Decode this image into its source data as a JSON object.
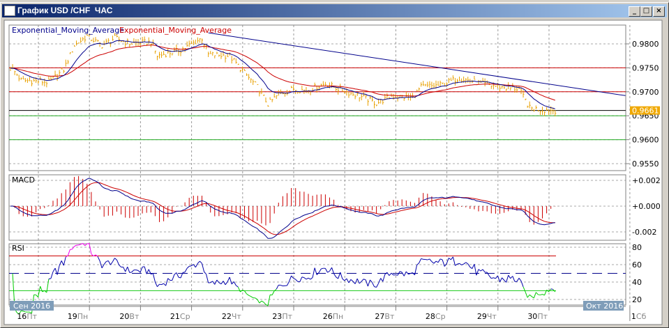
{
  "window": {
    "title": "График USD /CHF  ЧАС",
    "minimize": "_",
    "maximize": "□",
    "close": "×"
  },
  "legend": {
    "fast_ema": "Exponential_Moving_Average",
    "slow_ema": "Exponential_Moving_Average"
  },
  "price_axis": [
    "0.9800",
    "0.9750",
    "0.9700",
    "0.9650",
    "0.9600",
    "0.9550"
  ],
  "current_price": "0.9661",
  "macd": {
    "label": "MACD",
    "axis": [
      "+0.002",
      "+0.000",
      "-0.002"
    ]
  },
  "rsi": {
    "label": "RSI",
    "axis": [
      "80",
      "60",
      "40",
      "20"
    ]
  },
  "time_axis": {
    "month_start": "Сен 2016",
    "month_end": "Окт 2016",
    "days": [
      {
        "d": "16",
        "w": "Пт"
      },
      {
        "d": "19",
        "w": "Пн"
      },
      {
        "d": "20",
        "w": "Вт"
      },
      {
        "d": "21",
        "w": "Ср"
      },
      {
        "d": "22",
        "w": "Чт"
      },
      {
        "d": "23",
        "w": "Пт"
      },
      {
        "d": "26",
        "w": "Пн"
      },
      {
        "d": "27",
        "w": "Вт"
      },
      {
        "d": "28",
        "w": "Ср"
      },
      {
        "d": "29",
        "w": "Чт"
      },
      {
        "d": "30",
        "w": "Пт"
      },
      {
        "d": "1",
        "w": "Сб"
      }
    ]
  },
  "colors": {
    "candles": "#e8a000",
    "fast": "#00008b",
    "slow": "#cc0000",
    "support": "#22aa22",
    "resistance": "#cc0000",
    "current_bg": "#f0a800"
  },
  "chart_data": {
    "type": "line",
    "x_unit": "hourly bar index",
    "xlim": [
      0,
      289
    ],
    "price": {
      "ylim": [
        0.953,
        0.9835
      ],
      "keyframes": [
        [
          0,
          0.9753
        ],
        [
          5,
          0.9724
        ],
        [
          18,
          0.972
        ],
        [
          25,
          0.9746
        ],
        [
          30,
          0.9797
        ],
        [
          36,
          0.9816
        ],
        [
          43,
          0.9797
        ],
        [
          49,
          0.9812
        ],
        [
          56,
          0.9801
        ],
        [
          66,
          0.9804
        ],
        [
          69,
          0.9775
        ],
        [
          80,
          0.9787
        ],
        [
          90,
          0.9812
        ],
        [
          93,
          0.9778
        ],
        [
          103,
          0.9775
        ],
        [
          110,
          0.9739
        ],
        [
          116,
          0.971
        ],
        [
          121,
          0.9674
        ],
        [
          126,
          0.9695
        ],
        [
          133,
          0.9706
        ],
        [
          139,
          0.9703
        ],
        [
          148,
          0.9717
        ],
        [
          156,
          0.9703
        ],
        [
          166,
          0.9688
        ],
        [
          172,
          0.9676
        ],
        [
          179,
          0.9691
        ],
        [
          189,
          0.9688
        ],
        [
          193,
          0.971
        ],
        [
          202,
          0.9714
        ],
        [
          211,
          0.9729
        ],
        [
          221,
          0.9717
        ],
        [
          231,
          0.971
        ],
        [
          239,
          0.9706
        ],
        [
          244,
          0.9666
        ],
        [
          249,
          0.9663
        ],
        [
          256,
          0.9661
        ]
      ],
      "ema_periods": [
        12,
        34
      ],
      "trendline": [
        [
          93,
          0.9823
        ],
        [
          289,
          0.9692
        ]
      ],
      "resistance": [
        0.975,
        0.97
      ],
      "support": [
        0.965,
        0.96
      ],
      "current": 0.9661
    },
    "macd": {
      "ylim": [
        -0.0027,
        0.0027
      ],
      "fast": 12,
      "slow": 26,
      "signal": 9
    },
    "rsi": {
      "ylim": [
        14,
        86
      ],
      "period": 14,
      "levels": [
        70,
        50,
        30
      ]
    },
    "day_ticks": [
      0,
      24,
      48,
      72,
      96,
      120,
      144,
      168,
      192,
      216,
      240,
      278
    ]
  }
}
